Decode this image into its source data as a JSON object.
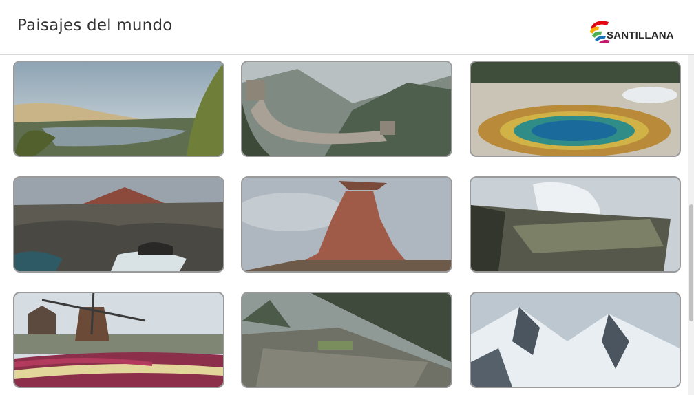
{
  "header": {
    "title": "Paisajes del mundo",
    "logo_text": "SANTILLANA"
  },
  "landscapes": [
    {
      "name": "oasis-desert",
      "icon": "oasis-image"
    },
    {
      "name": "great-wall",
      "icon": "great-wall-image"
    },
    {
      "name": "hot-spring",
      "icon": "hot-spring-image"
    },
    {
      "name": "volcanic-coast",
      "icon": "volcanic-coast-image"
    },
    {
      "name": "rock-formation",
      "icon": "rock-formation-image"
    },
    {
      "name": "volcano-plateau",
      "icon": "volcano-plateau-image"
    },
    {
      "name": "windmill-tulips",
      "icon": "windmill-image"
    },
    {
      "name": "machu-picchu",
      "icon": "machu-picchu-image"
    },
    {
      "name": "snowy-mountains",
      "icon": "snowy-mountains-image"
    }
  ],
  "colors": {
    "logo_red": "#e30613",
    "logo_yellow": "#f9b000",
    "logo_green": "#4caf50",
    "logo_blue": "#1a73b8",
    "logo_magenta": "#c2186b"
  }
}
